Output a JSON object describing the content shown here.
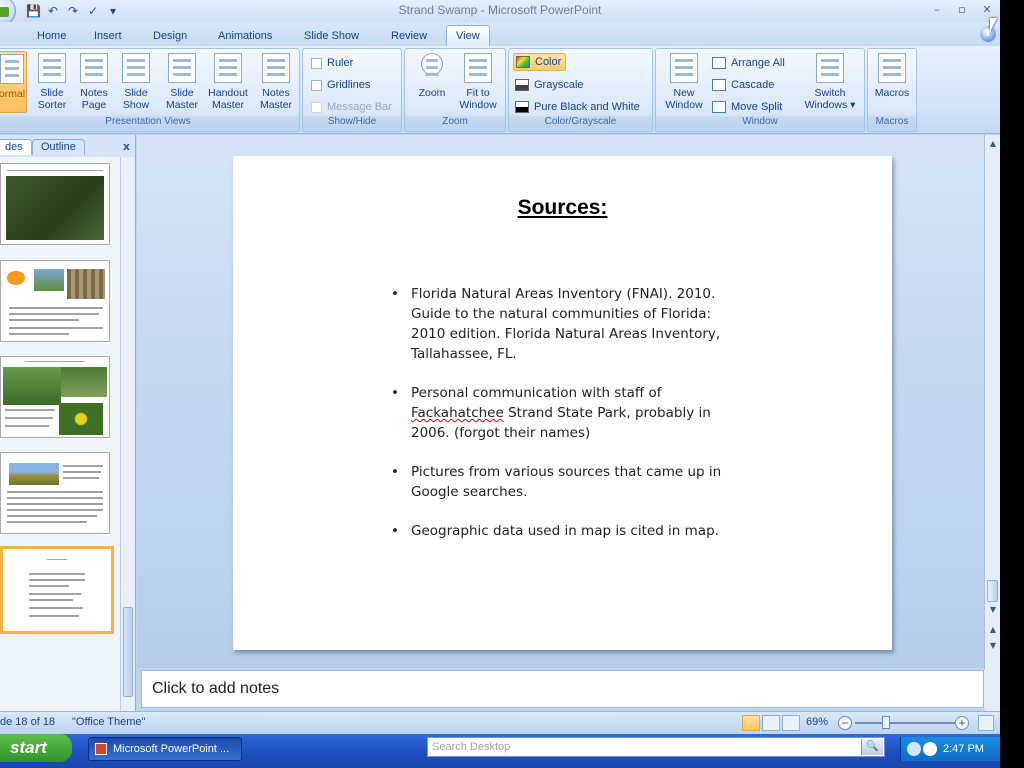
{
  "window": {
    "title": "Strand Swamp - Microsoft PowerPoint",
    "minimize": "–",
    "restore": "▫",
    "close": "✕"
  },
  "qat": {
    "save": "💾",
    "undo": "↶",
    "redo": "↷",
    "spell": "✓",
    "more": "▾"
  },
  "tabs": [
    {
      "label": "Home"
    },
    {
      "label": "Insert"
    },
    {
      "label": "Design"
    },
    {
      "label": "Animations"
    },
    {
      "label": "Slide Show"
    },
    {
      "label": "Review"
    },
    {
      "label": "View",
      "active": true
    }
  ],
  "ribbon": {
    "presentation_views": {
      "label": "Presentation Views",
      "buttons": [
        {
          "line1": "ormal",
          "line2": ""
        },
        {
          "line1": "Slide",
          "line2": "Sorter"
        },
        {
          "line1": "Notes",
          "line2": "Page"
        },
        {
          "line1": "Slide",
          "line2": "Show"
        },
        {
          "line1": "Slide",
          "line2": "Master"
        },
        {
          "line1": "Handout",
          "line2": "Master"
        },
        {
          "line1": "Notes",
          "line2": "Master"
        }
      ]
    },
    "show_hide": {
      "label": "Show/Hide",
      "ruler": "Ruler",
      "gridlines": "Gridlines",
      "message_bar": "Message Bar"
    },
    "zoom": {
      "label": "Zoom",
      "zoom": "Zoom",
      "fit_line1": "Fit to",
      "fit_line2": "Window"
    },
    "color_grayscale": {
      "label": "Color/Grayscale",
      "color": "Color",
      "grayscale": "Grayscale",
      "pure_bw": "Pure Black and White"
    },
    "window": {
      "label": "Window",
      "new_line1": "New",
      "new_line2": "Window",
      "arrange_all": "Arrange All",
      "cascade": "Cascade",
      "move_split": "Move Split",
      "switch_line1": "Switch",
      "switch_line2": "Windows ▾"
    },
    "macros": {
      "label": "Macros",
      "macros": "Macros"
    }
  },
  "left_pane": {
    "tab_slides": "des",
    "tab_outline": "Outline",
    "close": "x"
  },
  "slide": {
    "title": "Sources:",
    "bullets": {
      "b1": "Florida Natural Areas Inventory (FNAI). 2010. Guide to the natural communities of Florida: 2010 edition. Florida Natural Areas Inventory, Tallahassee, FL.",
      "b2_pre": "Personal communication with staff of ",
      "b2_mis": "Fackahatchee",
      "b2_post": " Strand State Park, probably in 2006. (forgot their names)",
      "b3": "Pictures from various sources that came up in Google searches.",
      "b4": "Geographic data used in map is cited in map."
    }
  },
  "notes": {
    "placeholder": "Click to add notes"
  },
  "status": {
    "slide_of": "de 18 of 18",
    "theme": "\"Office Theme\"",
    "zoom_level": "69%",
    "zoom_out": "−",
    "zoom_in": "+"
  },
  "taskbar": {
    "start": "start",
    "task_item": "Microsoft PowerPoint ...",
    "search_placeholder": "Search Desktop",
    "search_go": "🔍",
    "time": "2:47 PM"
  }
}
